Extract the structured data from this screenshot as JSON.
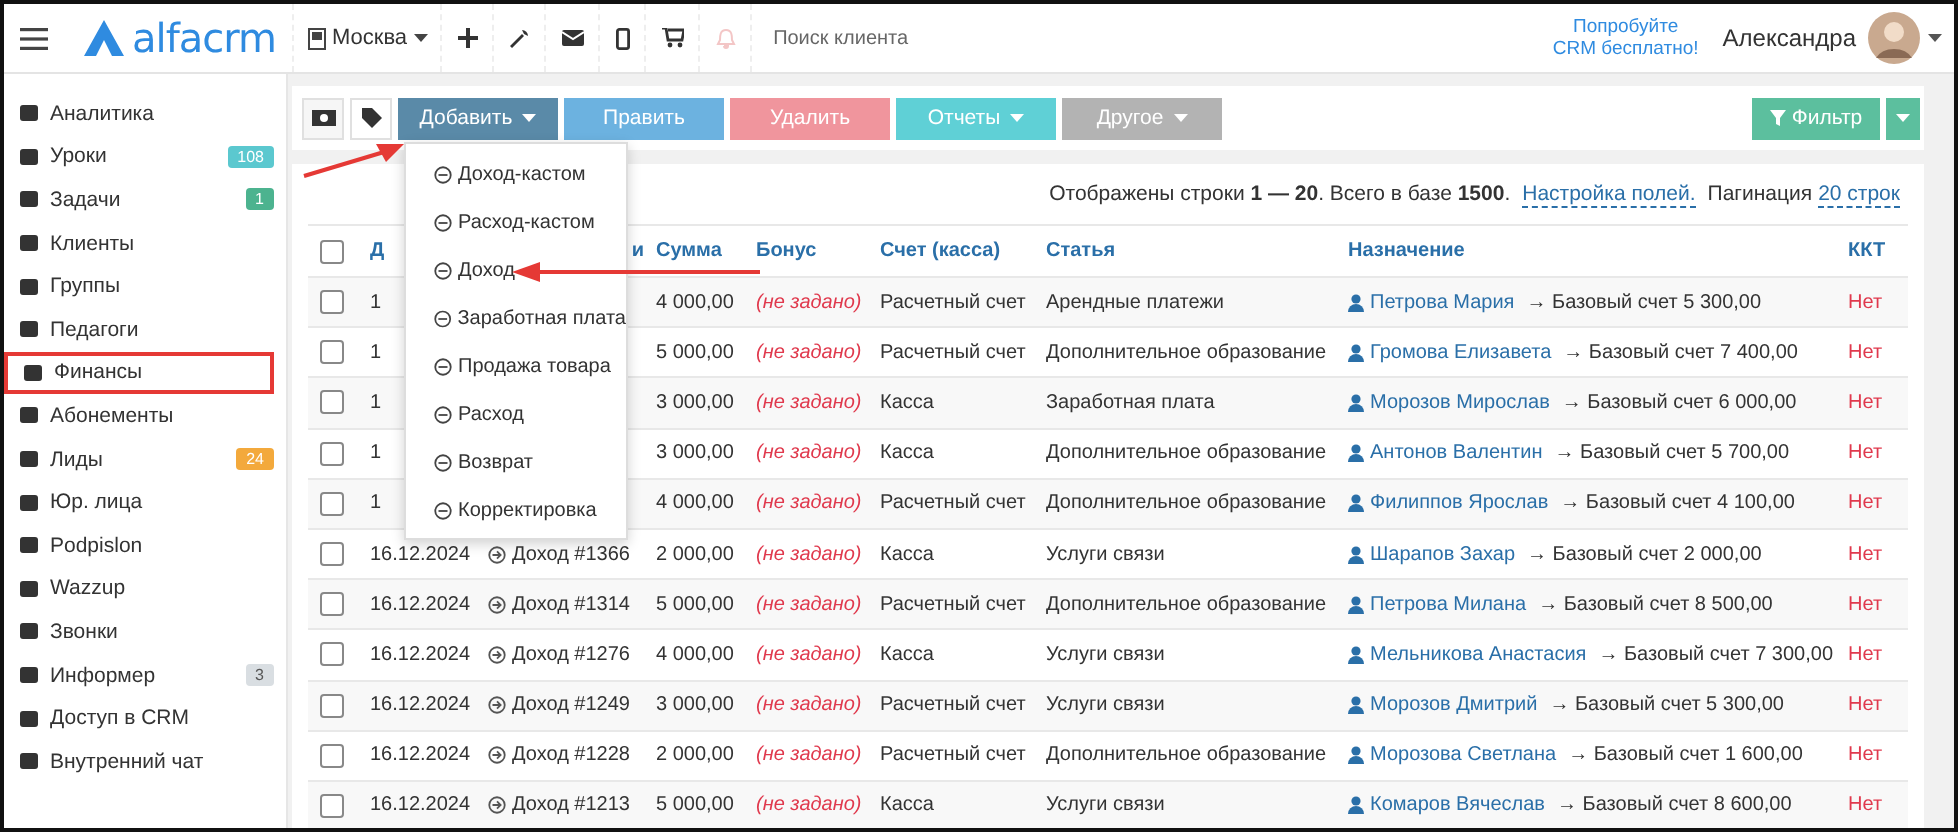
{
  "topbar": {
    "logo": "alfacrm",
    "branch": "Москва",
    "search_placeholder": "Поиск клиента",
    "promo": [
      "Попробуйте",
      "CRM бесплатно!"
    ],
    "user": "Александра"
  },
  "sidebar": {
    "items": [
      {
        "label": "Аналитика",
        "boxed": false
      },
      {
        "label": "Уроки",
        "badge": "108",
        "color": "#5bc8cf",
        "boxed": false
      },
      {
        "label": "Задачи",
        "badge": "1",
        "color": "#4cb38f",
        "boxed": false
      },
      {
        "label": "Клиенты",
        "boxed": false
      },
      {
        "label": "Группы",
        "boxed": false
      },
      {
        "label": "Педагоги",
        "boxed": false
      },
      {
        "label": "Финансы",
        "boxed": true
      },
      {
        "label": "Абонементы",
        "boxed": false
      },
      {
        "label": "Лиды",
        "badge": "24",
        "color": "#f3a93c",
        "boxed": false
      },
      {
        "label": "Юр. лица",
        "boxed": false
      },
      {
        "label": "Podpislon",
        "boxed": false
      },
      {
        "label": "Wazzup",
        "boxed": false
      },
      {
        "label": "Звонки",
        "boxed": false
      },
      {
        "label": "Информер",
        "badge": "3",
        "color": "#d9dee2",
        "boxed": false
      },
      {
        "label": "Доступ в CRM",
        "boxed": false
      },
      {
        "label": "Внутренний чат",
        "boxed": false
      }
    ]
  },
  "toolbar": {
    "buttons": [
      {
        "label": "Добавить",
        "kind": "add",
        "caret": true
      },
      {
        "label": "Править",
        "kind": "edit",
        "caret": false
      },
      {
        "label": "Удалить",
        "kind": "delete",
        "caret": false
      },
      {
        "label": "Отчеты",
        "kind": "reports",
        "caret": true
      },
      {
        "label": "Другое",
        "kind": "other",
        "caret": true
      }
    ],
    "filter": "Фильтр"
  },
  "dropdown": {
    "items": [
      "Доход-кастом",
      "Расход-кастом",
      "Доход",
      "Заработная плата",
      "Продажа товара",
      "Расход",
      "Возврат",
      "Корректировка"
    ]
  },
  "info": {
    "text": "Отображены строки **1 — 20**. Всего в базе **1500**.",
    "settings_link": "Настройка полей.",
    "pagination_label": "Пагинация",
    "pagination_link": "20 строк"
  },
  "table": {
    "all_checked": false,
    "columns": [
      "Д",
      "и",
      "Сумма",
      "Бонус",
      "Счет (касса)",
      "Статья",
      "Назначение",
      "ККТ"
    ],
    "rows": [
      {
        "checked": false,
        "date": "1",
        "amount": "4 000,00",
        "bonus": "(не задано)",
        "account": "Расчетный счет",
        "article": "Арендные платежи",
        "client": "Петрова Мария",
        "target": "→ Базовый счет 5 300,00",
        "kkt": "Нет"
      },
      {
        "checked": false,
        "date": "1",
        "amount": "5 000,00",
        "bonus": "(не задано)",
        "account": "Расчетный счет",
        "article": "Дополнительное образование",
        "client": "Громова Елизавета",
        "target": "→ Базовый счет 7 400,00",
        "kkt": "Нет"
      },
      {
        "checked": false,
        "date": "1",
        "amount": "3 000,00",
        "bonus": "(не задано)",
        "account": "Касса",
        "article": "Заработная плата",
        "client": "Морозов Мирослав",
        "target": "→ Базовый счет 6 000,00",
        "kkt": "Нет"
      },
      {
        "checked": false,
        "date": "1",
        "amount": "3 000,00",
        "bonus": "(не задано)",
        "account": "Касса",
        "article": "Дополнительное образование",
        "client": "Антонов Валентин",
        "target": "→ Базовый счет 5 700,00",
        "kkt": "Нет"
      },
      {
        "checked": false,
        "date": "1",
        "amount": "4 000,00",
        "bonus": "(не задано)",
        "account": "Расчетный счет",
        "article": "Дополнительное образование",
        "client": "Филиппов Ярослав",
        "target": "→ Базовый счет 4 100,00",
        "kkt": "Нет"
      },
      {
        "checked": false,
        "date": "16.12.2024",
        "type": "Доход #1366",
        "amount": "2 000,00",
        "bonus": "(не задано)",
        "account": "Касса",
        "article": "Услуги связи",
        "client": "Шарапов Захар",
        "target": "→ Базовый счет 2 000,00",
        "kkt": "Нет"
      },
      {
        "checked": false,
        "date": "16.12.2024",
        "type": "Доход #1314",
        "amount": "5 000,00",
        "bonus": "(не задано)",
        "account": "Расчетный счет",
        "article": "Дополнительное образование",
        "client": "Петрова Милана",
        "target": "→ Базовый счет 8 500,00",
        "kkt": "Нет"
      },
      {
        "checked": false,
        "date": "16.12.2024",
        "type": "Доход #1276",
        "amount": "4 000,00",
        "bonus": "(не задано)",
        "account": "Касса",
        "article": "Услуги связи",
        "client": "Мельникова Анастасия",
        "target": "→ Базовый счет 7 300,00",
        "kkt": "Нет"
      },
      {
        "checked": false,
        "date": "16.12.2024",
        "type": "Доход #1249",
        "amount": "3 000,00",
        "bonus": "(не задано)",
        "account": "Расчетный счет",
        "article": "Услуги связи",
        "client": "Морозов Дмитрий",
        "target": "→ Базовый счет 5 300,00",
        "kkt": "Нет"
      },
      {
        "checked": false,
        "date": "16.12.2024",
        "type": "Доход #1228",
        "amount": "2 000,00",
        "bonus": "(не задано)",
        "account": "Расчетный счет",
        "article": "Дополнительное образование",
        "client": "Морозова Светлана",
        "target": "→ Базовый счет 1 600,00",
        "kkt": "Нет"
      },
      {
        "checked": false,
        "date": "16.12.2024",
        "type": "Доход #1213",
        "amount": "5 000,00",
        "bonus": "(не задано)",
        "account": "Касса",
        "article": "Услуги связи",
        "client": "Комаров Вячеслав",
        "target": "→ Базовый счет 8 600,00",
        "kkt": "Нет"
      }
    ]
  }
}
